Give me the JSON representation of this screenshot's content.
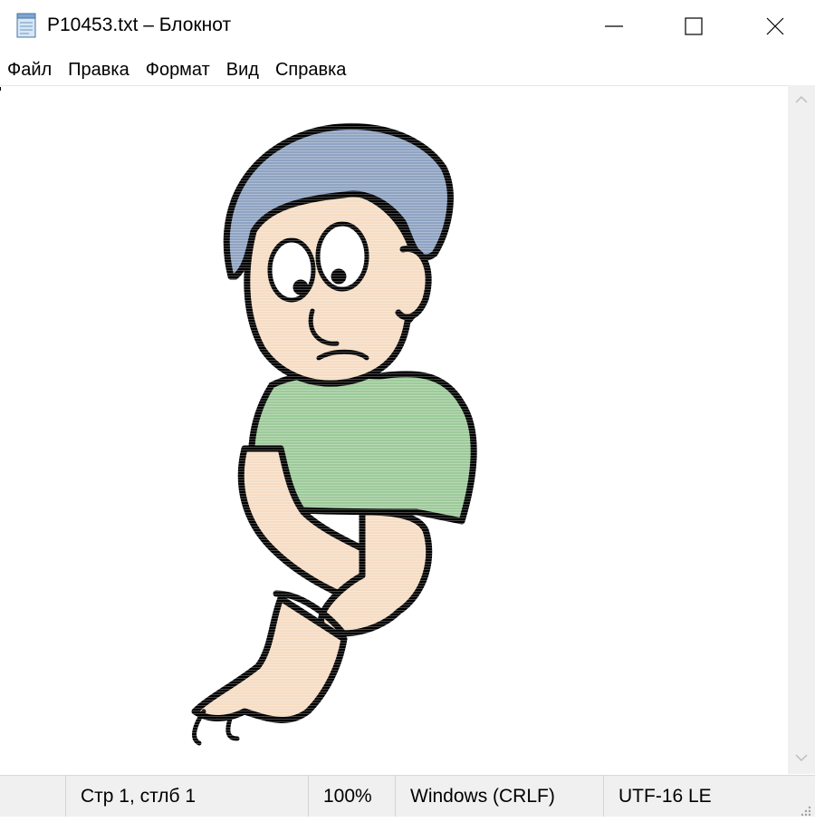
{
  "window": {
    "title": "P10453.txt – Блокнот",
    "icon": "notepad-icon"
  },
  "menu": {
    "items": [
      "Файл",
      "Правка",
      "Формат",
      "Вид",
      "Справка"
    ]
  },
  "editor": {
    "content_description": "cartoon-illustration",
    "colors": {
      "hair": "#8fa3c2",
      "skin": "#f5dcc4",
      "shirt": "#9dca9a",
      "outline": "#000000"
    }
  },
  "statusbar": {
    "position": "Стр 1, стлб 1",
    "zoom": "100%",
    "line_endings": "Windows (CRLF)",
    "encoding": "UTF-16 LE"
  }
}
